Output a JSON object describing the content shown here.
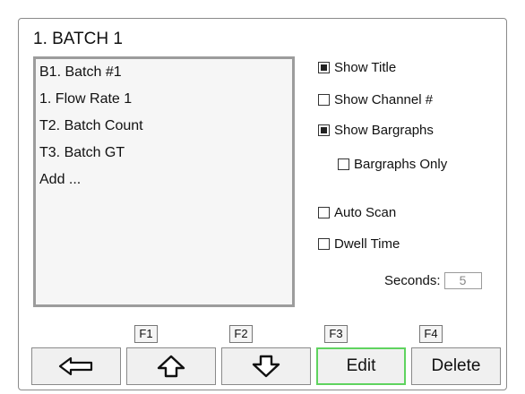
{
  "title": "1. BATCH 1",
  "list": {
    "items": [
      "B1. Batch #1",
      "1. Flow Rate 1",
      "T2. Batch Count",
      "T3. Batch GT",
      "Add ..."
    ]
  },
  "options": {
    "show_title": {
      "label": "Show Title",
      "checked": true
    },
    "show_channel": {
      "label": "Show Channel #",
      "checked": false
    },
    "show_bargraphs": {
      "label": "Show Bargraphs",
      "checked": true
    },
    "bargraphs_only": {
      "label": "Bargraphs Only",
      "checked": false
    },
    "auto_scan": {
      "label": "Auto Scan",
      "checked": false
    },
    "dwell_time": {
      "label": "Dwell Time",
      "checked": false
    }
  },
  "seconds": {
    "label": "Seconds:",
    "value": "5"
  },
  "function_keys": [
    "F1",
    "F2",
    "F3",
    "F4"
  ],
  "buttons": {
    "back_icon": "left-arrow-icon",
    "up_icon": "up-arrow-icon",
    "down_icon": "down-arrow-icon",
    "edit_label": "Edit",
    "delete_label": "Delete"
  },
  "colors": {
    "edit_border": "#5fd35f"
  }
}
